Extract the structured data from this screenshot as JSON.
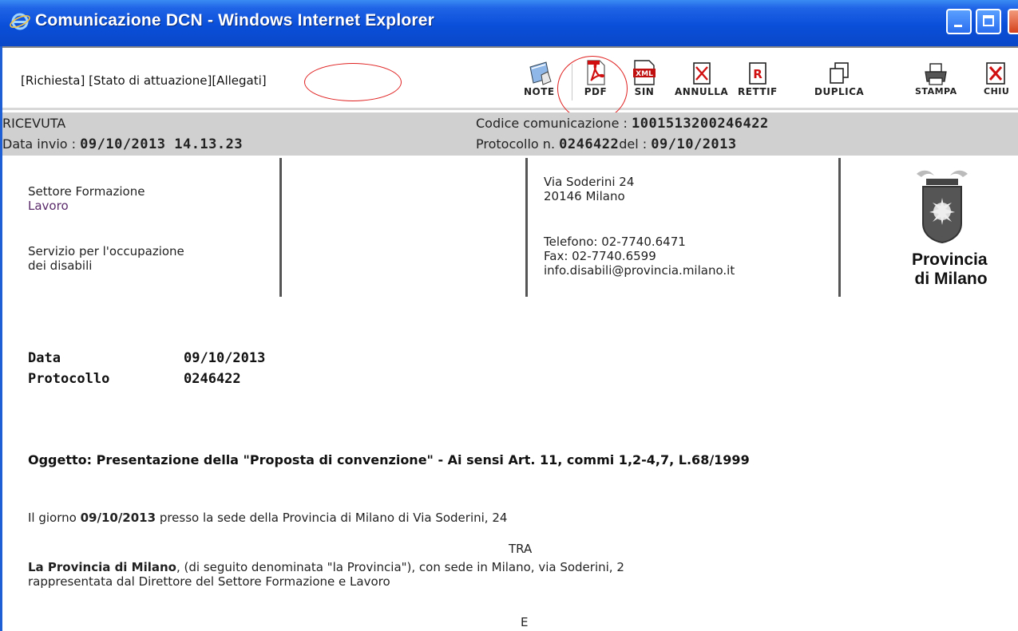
{
  "window": {
    "title": "Comunicazione DCN - Windows Internet Explorer"
  },
  "nav_links": [
    "[Richiesta]",
    "[Stato di attuazione]",
    "[Allegati]"
  ],
  "toolbar": {
    "note": "NOTE",
    "pdf": "PDF",
    "sin": "SIN",
    "annulla": "ANNULLA",
    "rettif": "RETTIF",
    "duplica": "DUPLICA",
    "stampa": "STAMPA",
    "chiudi": "CHIU"
  },
  "header": {
    "status": "RICEVUTA",
    "data_invio_label": "Data invio : ",
    "data_invio_value": "09/10/2013 14.13.23",
    "codice_label": "Codice comunicazione : ",
    "codice_value": "1001513200246422",
    "protocollo_label": "Protocollo n. ",
    "protocollo_value": "0246422",
    "del_label": "del : ",
    "del_value": "09/10/2013"
  },
  "letterhead": {
    "settore_line1": "Settore Formazione",
    "settore_line2": "Lavoro",
    "servizio_line1": "Servizio per l'occupazione",
    "servizio_line2": "dei disabili",
    "address_line1": "Via Soderini 24",
    "address_line2": "20146 Milano",
    "telefono": "Telefono: 02-7740.6471",
    "fax": "Fax: 02-7740.6599",
    "email": "info.disabili@provincia.milano.it",
    "logo_line1": "Provincia",
    "logo_line2": "di Milano"
  },
  "body": {
    "data_label": "Data",
    "data_value": "09/10/2013",
    "protocollo_label": "Protocollo",
    "protocollo_value": "0246422",
    "oggetto": "Oggetto: Presentazione della \"Proposta di convenzione\" - Ai sensi Art. 11, commi 1,2-4,7, L.68/1999",
    "giorno_pre": "Il giorno ",
    "giorno_date": "09/10/2013",
    "giorno_post": " presso la sede della Provincia di Milano di Via Soderini, 24",
    "tra": "TRA",
    "provincia_bold": "La Provincia di Milano",
    "provincia_rest": ", (di seguito denominata \"la Provincia\"), con sede in Milano, via Soderini, 2",
    "rappresentata": "rappresentata dal Direttore del Settore Formazione e Lavoro",
    "e": "E"
  },
  "colors": {
    "titlebar": "#0a4fd9",
    "header_band": "#d0d0d0",
    "annotation_circle": "#e02020"
  }
}
